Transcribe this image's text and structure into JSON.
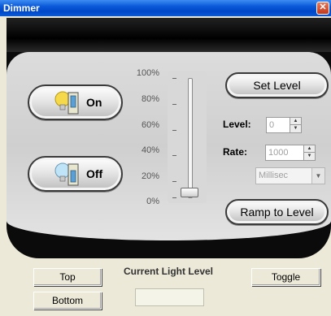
{
  "window": {
    "title": "Dimmer",
    "close_glyph": "✕"
  },
  "controls": {
    "on_label": "On",
    "off_label": "Off",
    "set_level_label": "Set Level",
    "ramp_label": "Ramp to Level",
    "level_label": "Level:",
    "level_value": "0",
    "rate_label": "Rate:",
    "rate_value": "1000",
    "rate_unit": "Millisec"
  },
  "slider": {
    "scale": [
      "100%",
      "80%",
      "60%",
      "40%",
      "20%",
      "0%"
    ],
    "value_percent": 0
  },
  "bottom": {
    "top_label": "Top",
    "bottom_label": "Bottom",
    "toggle_label": "Toggle",
    "current_light_label": "Current Light Level",
    "current_light_value": ""
  },
  "colors": {
    "titlebar": "#0a58d8",
    "panel_dark": "#0b0b0b",
    "panel_light": "#dcdcdc",
    "bulb_on": "#f6d84b",
    "bulb_off": "#bfe4f7"
  },
  "icons": [
    "bulb-on-icon",
    "bulb-off-icon",
    "close-icon",
    "spin-up-icon",
    "spin-down-icon",
    "dropdown-arrow-icon"
  ]
}
